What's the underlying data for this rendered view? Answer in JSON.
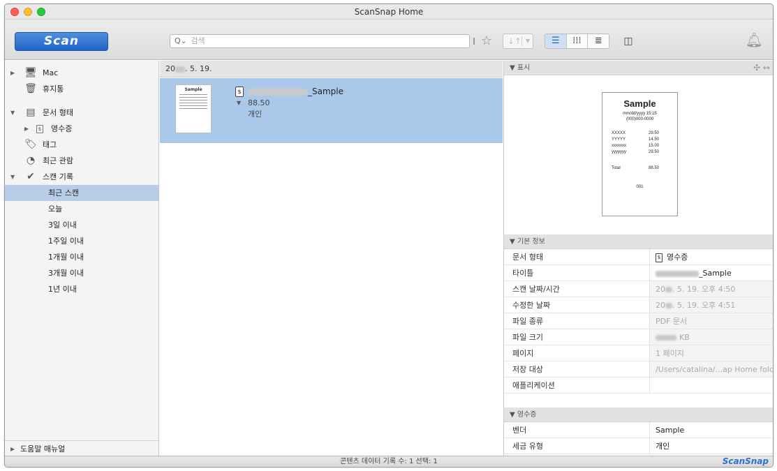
{
  "window": {
    "title": "ScanSnap Home"
  },
  "toolbar": {
    "scan_label": "Scan",
    "search_placeholder": "검색",
    "search_icon": "Q⌄"
  },
  "sidebar": {
    "items": [
      {
        "label": "Mac"
      },
      {
        "label": "휴지통"
      },
      {
        "label": "문서 형태"
      },
      {
        "label": "영수증"
      },
      {
        "label": "태그"
      },
      {
        "label": "최근 관람"
      },
      {
        "label": "스캔 기록"
      },
      {
        "label": "최근 스캔"
      },
      {
        "label": "오늘"
      },
      {
        "label": "3일 이내"
      },
      {
        "label": "1주일 이내"
      },
      {
        "label": "1개월 이내"
      },
      {
        "label": "3개월 이내"
      },
      {
        "label": "1년 이내"
      }
    ],
    "help": "도움말 매뉴얼"
  },
  "content": {
    "date_prefix": "20",
    "date_suffix": ". 5. 19.",
    "item": {
      "title_suffix": "_Sample",
      "amount": "88.50",
      "tax": "개인",
      "thumb_title": "Sample"
    }
  },
  "preview": {
    "header": "▼ 표시",
    "receipt": {
      "title": "Sample",
      "datetime": "mm/dd/yyyy  15:15",
      "phone": "(000)000-0000",
      "lines": [
        {
          "label": "XXXXX",
          "value": "29.50"
        },
        {
          "label": "YYYYY",
          "value": "14.50"
        },
        {
          "label": "xxxxxxx",
          "value": "15.00"
        },
        {
          "label": "yyyyyyy",
          "value": "29.50"
        }
      ],
      "total_label": "Total",
      "total_value": "88.50",
      "id": "001"
    }
  },
  "basic_info": {
    "header": "▼ 기본 정보",
    "rows": [
      {
        "key": "문서 형태",
        "value": "영수증"
      },
      {
        "key": "타이틀",
        "value": "_Sample"
      },
      {
        "key": "스캔 날짜/시간",
        "value_prefix": "20",
        "value": ". 5. 19. 오후 4:50"
      },
      {
        "key": "수정한 날짜",
        "value_prefix": "20",
        "value": ". 5. 19. 오후 4:51"
      },
      {
        "key": "파일 종류",
        "value": "PDF 문서"
      },
      {
        "key": "파일 크기",
        "value": "KB"
      },
      {
        "key": "페이지",
        "value": "1 페이지"
      },
      {
        "key": "저장 대상",
        "value": "/Users/catalina/...ap Home folder"
      },
      {
        "key": "애플리케이션",
        "value": ""
      }
    ]
  },
  "receipt_info": {
    "header": "▼ 영수증",
    "rows": [
      {
        "key": "벤더",
        "value": "Sample"
      },
      {
        "key": "세금 유형",
        "value": "개인"
      }
    ]
  },
  "status": {
    "text": "콘텐츠 데이터 기록 수: 1  선택: 1",
    "brand": "ScanSnap"
  }
}
